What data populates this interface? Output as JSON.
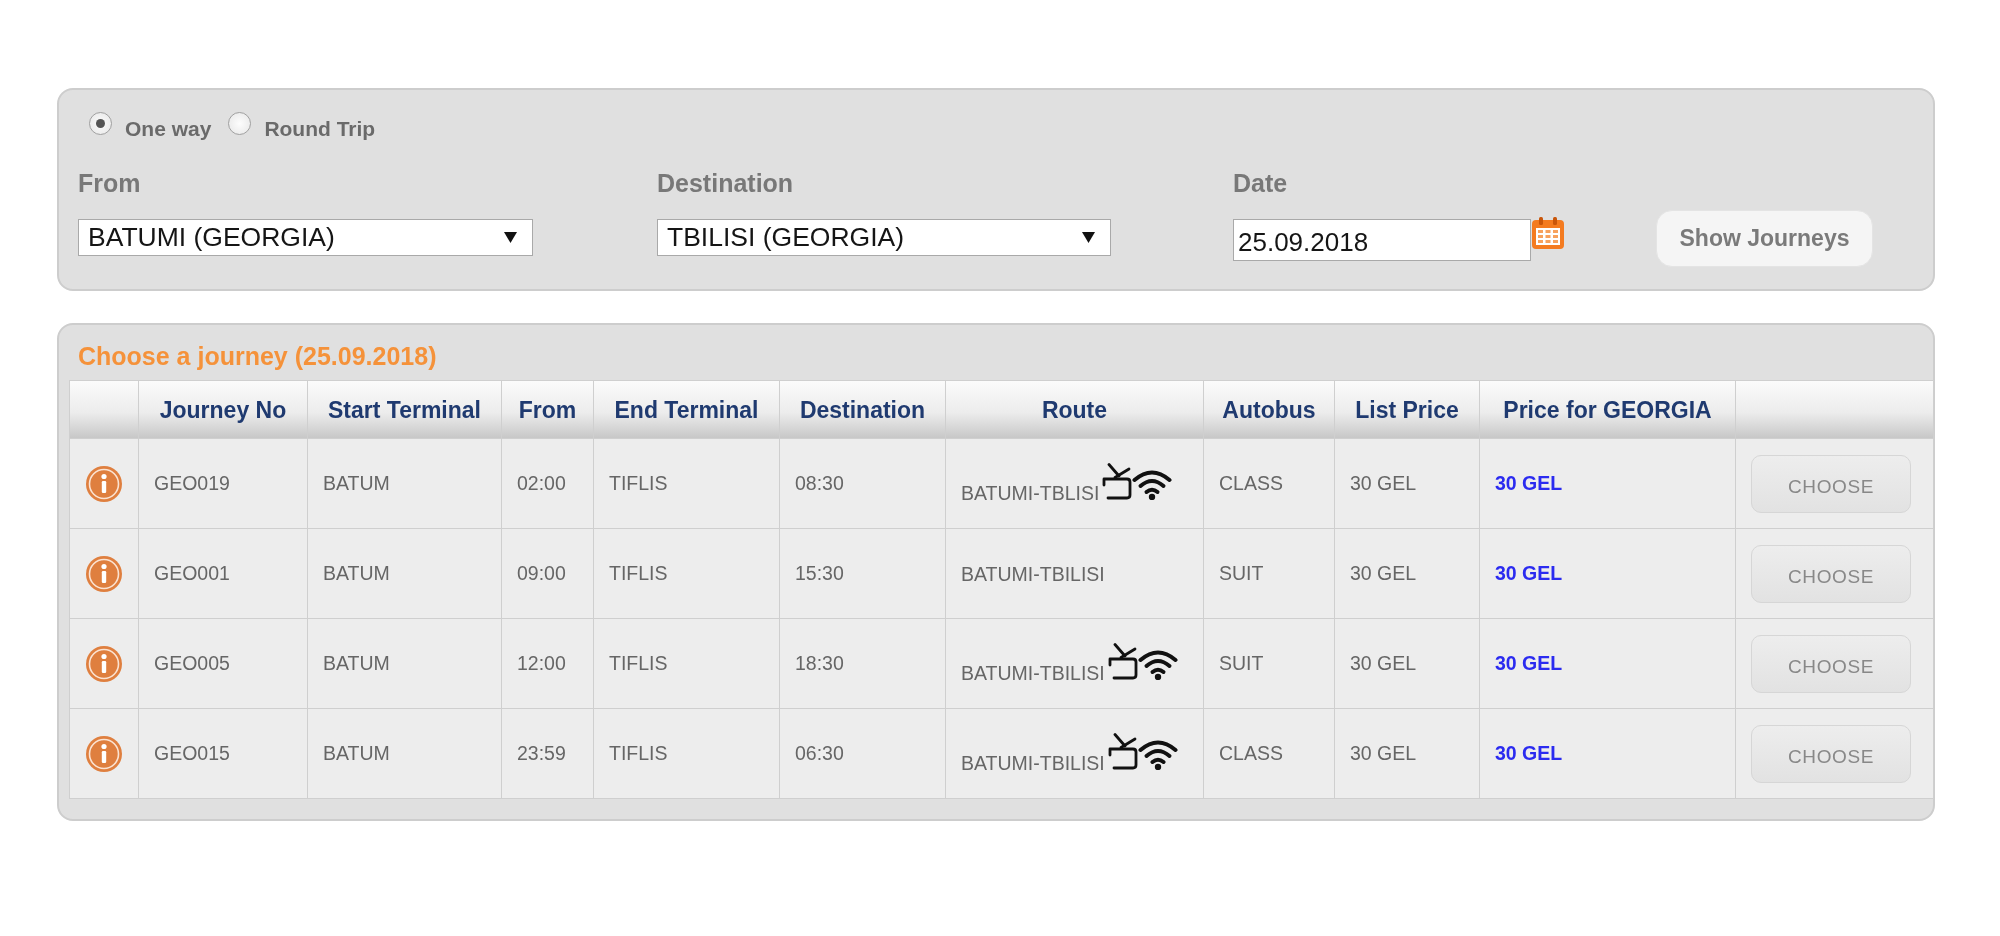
{
  "trip_type": [
    {
      "label": "One way",
      "selected": true
    },
    {
      "label": "Round Trip",
      "selected": false
    }
  ],
  "search": {
    "from": {
      "label": "From",
      "value": "BATUMI (GEORGIA)"
    },
    "destination": {
      "label": "Destination",
      "value": "TBILISI (GEORGIA)"
    },
    "date": {
      "label": "Date",
      "value": "25.09.2018"
    },
    "button": "Show Journeys"
  },
  "results": {
    "title": "Choose a journey (25.09.2018)",
    "columns": [
      "Journey No",
      "Start Terminal",
      "From",
      "End Terminal",
      "Destination",
      "Route",
      "Autobus",
      "List Price",
      "Price for GEORGIA"
    ],
    "rows": [
      {
        "journey_no": "GEO019",
        "start_terminal": "BATUM",
        "from": "02:00",
        "end_terminal": "TIFLIS",
        "destination": "08:30",
        "route": "BATUMI-TBLISI",
        "tv": true,
        "wifi": true,
        "autobus": "CLASS",
        "list_price": "30 GEL",
        "price_for_georgia": "30 GEL",
        "button": "CHOOSE"
      },
      {
        "journey_no": "GEO001",
        "start_terminal": "BATUM",
        "from": "09:00",
        "end_terminal": "TIFLIS",
        "destination": "15:30",
        "route": "BATUMI-TBILISI",
        "tv": false,
        "wifi": false,
        "autobus": "SUIT",
        "list_price": "30 GEL",
        "price_for_georgia": "30 GEL",
        "button": "CHOOSE"
      },
      {
        "journey_no": "GEO005",
        "start_terminal": "BATUM",
        "from": "12:00",
        "end_terminal": "TIFLIS",
        "destination": "18:30",
        "route": "BATUMI-TBILISI",
        "tv": true,
        "wifi": true,
        "autobus": "SUIT",
        "list_price": "30 GEL",
        "price_for_georgia": "30 GEL",
        "button": "CHOOSE"
      },
      {
        "journey_no": "GEO015",
        "start_terminal": "BATUM",
        "from": "23:59",
        "end_terminal": "TIFLIS",
        "destination": "06:30",
        "route": "BATUMI-TBILISI",
        "tv": true,
        "wifi": true,
        "autobus": "CLASS",
        "list_price": "30 GEL",
        "price_for_georgia": "30 GEL",
        "button": "CHOOSE"
      }
    ]
  }
}
